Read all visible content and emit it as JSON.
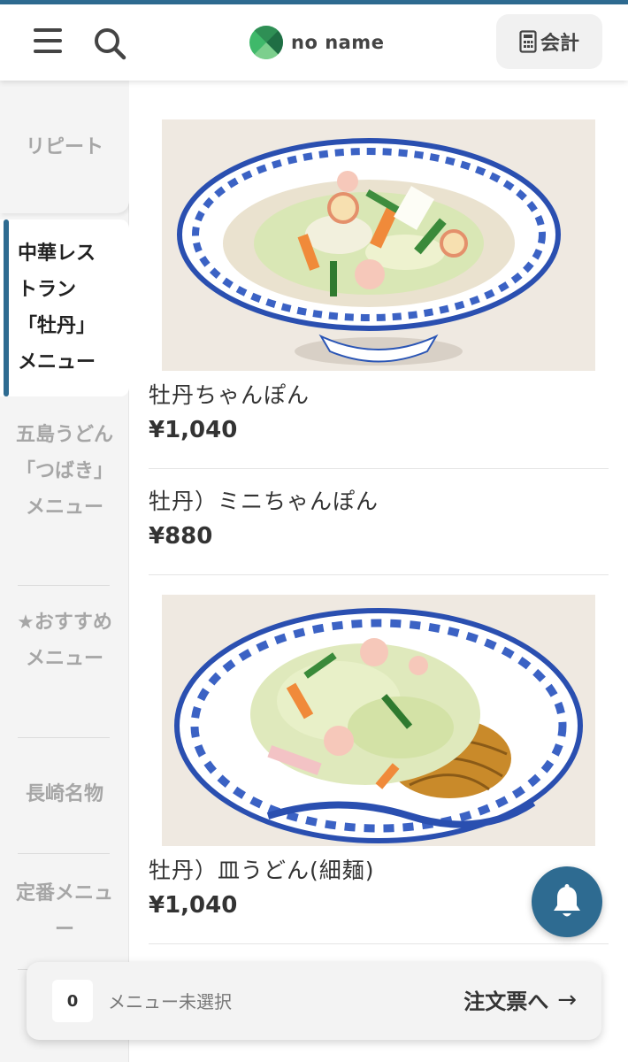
{
  "header": {
    "brand_name": "no name",
    "bill_label": "会計"
  },
  "sidebar": {
    "items": [
      {
        "label": "リピート"
      },
      {
        "label": "中華レストラン「牡丹」メニュー"
      },
      {
        "label": "五島うどん「つばき」メニュー"
      },
      {
        "label": "★おすすめメニュー"
      },
      {
        "label": "長崎名物"
      },
      {
        "label": "定番メニュー"
      }
    ]
  },
  "menu": {
    "items": [
      {
        "name": "牡丹ちゃんぽん",
        "price": "¥1,040",
        "image": "champon-bowl"
      },
      {
        "name": "牡丹）ミニちゃんぽん",
        "price": "¥880"
      },
      {
        "name": "牡丹）皿うどん(細麺)",
        "price": "¥1,040",
        "image": "sara-udon-plate"
      }
    ]
  },
  "order_bar": {
    "count": "0",
    "status": "メニュー未選択",
    "link_label": "注文票へ",
    "arrow": "→"
  },
  "icons": {
    "menu": "hamburger-icon",
    "search": "search-icon",
    "logo": "logo-icon",
    "bill": "calculator-icon",
    "bell": "bell-icon"
  },
  "colors": {
    "accent": "#2e6b91",
    "logo_green": "#2aa65a",
    "sidebar_bg": "#f4f4f4"
  }
}
